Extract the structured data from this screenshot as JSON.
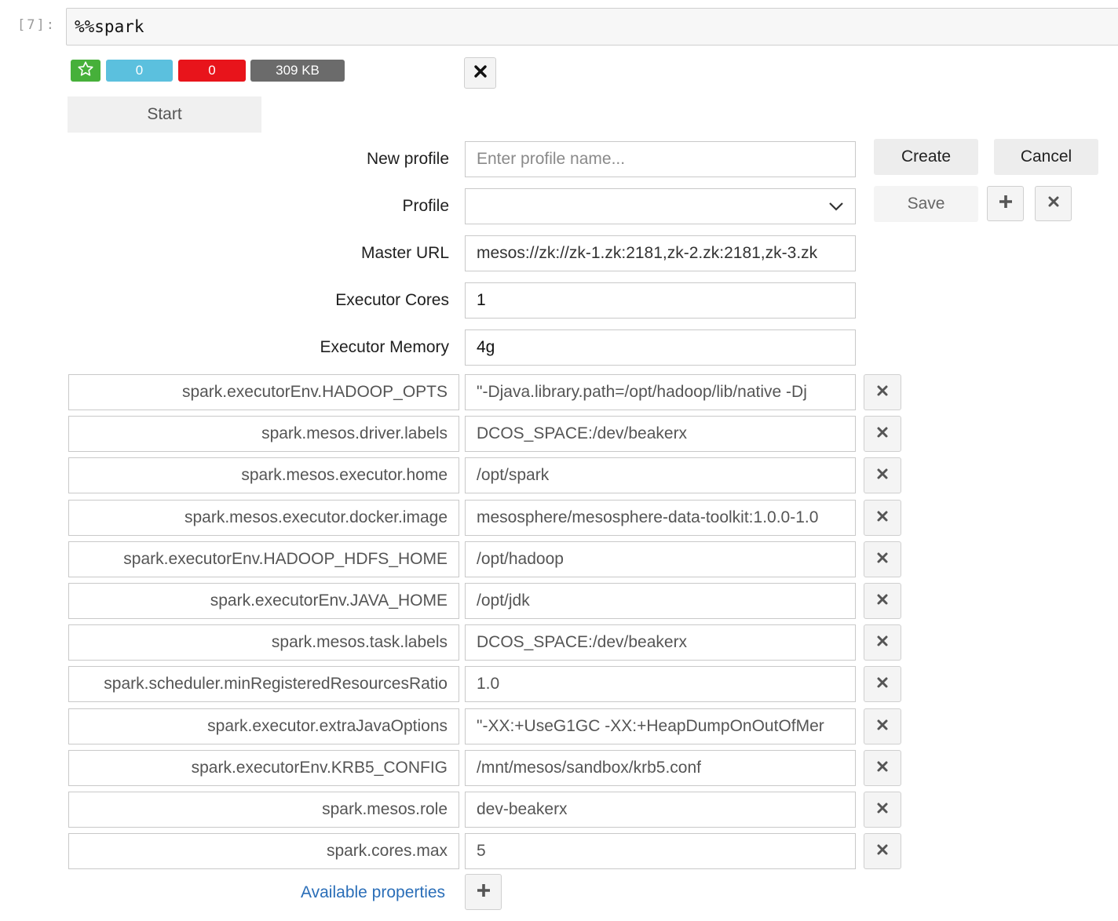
{
  "cell": {
    "prompt": "[7]:",
    "code": "%%spark"
  },
  "status": {
    "star_icon": "star-icon",
    "badge_blue": "0",
    "badge_red": "0",
    "badge_size": "309 KB",
    "colors": {
      "green": "#46b03a",
      "blue": "#5bc0de",
      "red": "#e8141b",
      "gray": "#6b6b6b"
    }
  },
  "start_button": "Start",
  "form": {
    "new_profile_label": "New profile",
    "new_profile_placeholder": "Enter profile name...",
    "profile_label": "Profile",
    "profile_value": "",
    "master_url_label": "Master URL",
    "master_url_value": "mesos://zk://zk-1.zk:2181,zk-2.zk:2181,zk-3.zk",
    "executor_cores_label": "Executor Cores",
    "executor_cores_value": "1",
    "executor_memory_label": "Executor Memory",
    "executor_memory_value": "4g"
  },
  "buttons": {
    "create": "Create",
    "cancel": "Cancel",
    "save": "Save"
  },
  "properties": [
    {
      "key": "spark.executorEnv.HADOOP_OPTS",
      "value": "\"-Djava.library.path=/opt/hadoop/lib/native -Dj"
    },
    {
      "key": "spark.mesos.driver.labels",
      "value": "DCOS_SPACE:/dev/beakerx"
    },
    {
      "key": "spark.mesos.executor.home",
      "value": "/opt/spark"
    },
    {
      "key": "spark.mesos.executor.docker.image",
      "value": "mesosphere/mesosphere-data-toolkit:1.0.0-1.0"
    },
    {
      "key": "spark.executorEnv.HADOOP_HDFS_HOME",
      "value": "/opt/hadoop"
    },
    {
      "key": "spark.executorEnv.JAVA_HOME",
      "value": "/opt/jdk"
    },
    {
      "key": "spark.mesos.task.labels",
      "value": "DCOS_SPACE:/dev/beakerx"
    },
    {
      "key": "spark.scheduler.minRegisteredResourcesRatio",
      "value": "1.0"
    },
    {
      "key": "spark.executor.extraJavaOptions",
      "value": "\"-XX:+UseG1GC -XX:+HeapDumpOnOutOfMer"
    },
    {
      "key": "spark.executorEnv.KRB5_CONFIG",
      "value": "/mnt/mesos/sandbox/krb5.conf"
    },
    {
      "key": "spark.mesos.role",
      "value": "dev-beakerx"
    },
    {
      "key": "spark.cores.max",
      "value": "5"
    }
  ],
  "available_properties_link": "Available properties"
}
